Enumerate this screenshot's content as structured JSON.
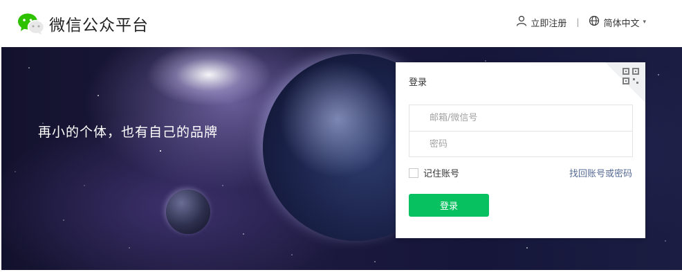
{
  "header": {
    "brand": "微信公众平台",
    "register_label": "立即注册",
    "separator": "|",
    "language_label": "简体中文",
    "language_caret": "▾"
  },
  "banner": {
    "slogan": "再小的个体，也有自己的品牌"
  },
  "login": {
    "title": "登录",
    "account_placeholder": "邮箱/微信号",
    "password_placeholder": "密码",
    "remember_label": "记住账号",
    "forgot_label": "找回账号或密码",
    "submit_label": "登录"
  },
  "colors": {
    "brand_green": "#07c160",
    "link_blue": "#576b95",
    "logo_green": "#2dc100"
  },
  "icons": {
    "logo": "wechat-logo-icon",
    "register": "user-icon",
    "language": "globe-icon",
    "qr": "qrcode-icon"
  }
}
